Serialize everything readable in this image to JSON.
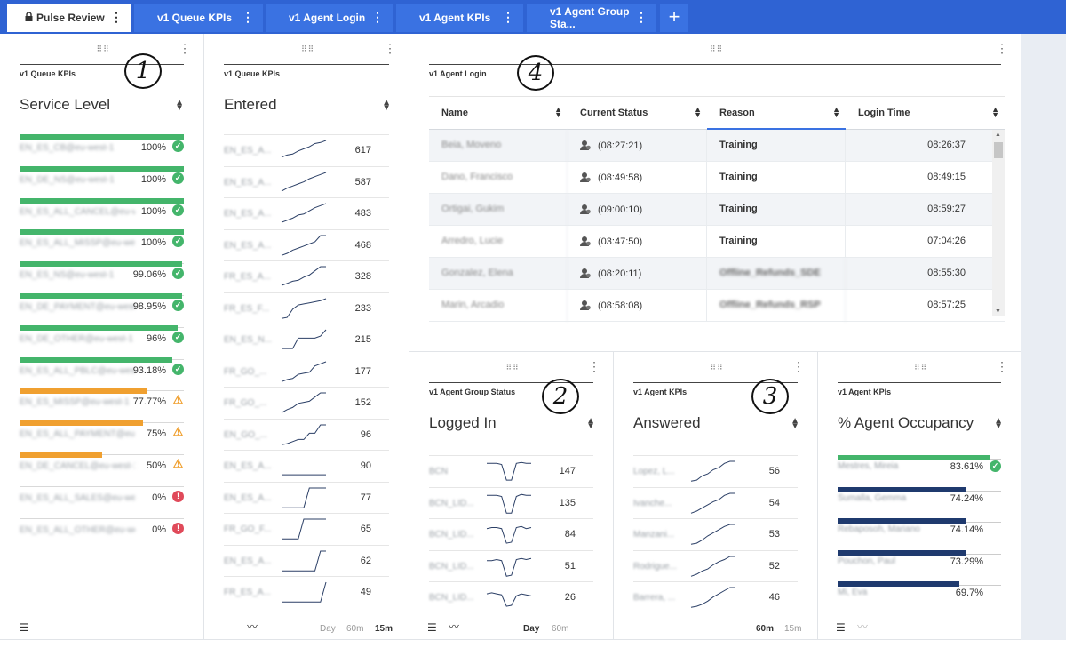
{
  "tabs": [
    {
      "label": "Pulse Review",
      "active": true,
      "locked": true
    },
    {
      "label": "v1 Queue KPIs"
    },
    {
      "label": "v1 Agent Login"
    },
    {
      "label": "v1 Agent KPIs"
    },
    {
      "label": "v1 Agent Group Sta..."
    }
  ],
  "add_tab_label": "+",
  "menu_glyph": "⋮",
  "drag_glyph": "⠿⠿",
  "callouts": [
    "1",
    "2",
    "3",
    "4"
  ],
  "service_level": {
    "label": "v1 Queue KPIs",
    "title": "Service Level",
    "rows": [
      {
        "name": "EN_ES_CB@eu-west-1",
        "value": "100%",
        "fill": 100,
        "status": "ok"
      },
      {
        "name": "EN_DE_NS@eu-west-1",
        "value": "100%",
        "fill": 100,
        "status": "ok"
      },
      {
        "name": "EN_ES_ALL_CANCEL@eu-we...",
        "value": "100%",
        "fill": 100,
        "status": "ok"
      },
      {
        "name": "EN_ES_ALL_MISSP@eu-we...",
        "value": "100%",
        "fill": 100,
        "status": "ok"
      },
      {
        "name": "EN_ES_NS@eu-west-1",
        "value": "99.06%",
        "fill": 99.06,
        "status": "ok"
      },
      {
        "name": "EN_DE_PAYMENT@eu-west",
        "value": "98.95%",
        "fill": 98.95,
        "status": "ok"
      },
      {
        "name": "EN_DE_OTHER@eu-west-1",
        "value": "96%",
        "fill": 96,
        "status": "ok"
      },
      {
        "name": "EN_ES_ALL_PBLC@eu-west",
        "value": "93.18%",
        "fill": 93.18,
        "status": "ok"
      },
      {
        "name": "EN_ES_MISSP@eu-west-1",
        "value": "77.77%",
        "fill": 77.77,
        "status": "warn"
      },
      {
        "name": "EN_ES_ALL_PAYMENT@eu...",
        "value": "75%",
        "fill": 75,
        "status": "warn"
      },
      {
        "name": "EN_DE_CANCEL@eu-west-1",
        "value": "50%",
        "fill": 50,
        "status": "warn"
      },
      {
        "name": "EN_ES_ALL_SALES@eu-we...",
        "value": "0%",
        "fill": 0,
        "status": "err"
      },
      {
        "name": "EN_ES_ALL_OTHER@eu-we...",
        "value": "0%",
        "fill": 0,
        "status": "err"
      }
    ],
    "colors": {
      "ok": "#44b56b",
      "warn": "#f0a030",
      "err": "#e04a5a"
    }
  },
  "entered": {
    "label": "v1 Queue KPIs",
    "title": "Entered",
    "rows": [
      {
        "name": "EN_ES_A...",
        "value": "617",
        "trend": [
          0.2,
          0.3,
          0.35,
          0.5,
          0.6,
          0.7,
          0.85,
          0.9,
          1
        ]
      },
      {
        "name": "EN_ES_A...",
        "value": "587",
        "trend": [
          0.1,
          0.25,
          0.35,
          0.45,
          0.55,
          0.7,
          0.8,
          0.9,
          1
        ]
      },
      {
        "name": "EN_ES_A...",
        "value": "483",
        "trend": [
          0.1,
          0.2,
          0.3,
          0.45,
          0.5,
          0.65,
          0.8,
          0.9,
          1
        ]
      },
      {
        "name": "EN_ES_A...",
        "value": "468",
        "trend": [
          0.05,
          0.15,
          0.3,
          0.4,
          0.5,
          0.6,
          0.7,
          1,
          1
        ]
      },
      {
        "name": "FR_ES_A...",
        "value": "328",
        "trend": [
          0.1,
          0.2,
          0.3,
          0.35,
          0.5,
          0.6,
          0.8,
          1,
          1
        ]
      },
      {
        "name": "FR_ES_F...",
        "value": "233",
        "trend": [
          0.05,
          0.1,
          0.5,
          0.7,
          0.75,
          0.8,
          0.85,
          0.9,
          1
        ]
      },
      {
        "name": "EN_ES_N...",
        "value": "215",
        "trend": [
          0.1,
          0.1,
          0.1,
          0.6,
          0.6,
          0.6,
          0.6,
          0.7,
          1
        ]
      },
      {
        "name": "FR_GO_...",
        "value": "177",
        "trend": [
          0.05,
          0.15,
          0.2,
          0.4,
          0.45,
          0.5,
          0.8,
          0.9,
          1
        ]
      },
      {
        "name": "FR_GO_...",
        "value": "152",
        "trend": [
          0.05,
          0.2,
          0.3,
          0.5,
          0.55,
          0.6,
          0.8,
          1,
          1
        ]
      },
      {
        "name": "EN_GO_...",
        "value": "96",
        "trend": [
          0.05,
          0.1,
          0.2,
          0.3,
          0.3,
          0.6,
          0.6,
          1,
          1
        ]
      },
      {
        "name": "EN_ES_A...",
        "value": "90",
        "trend": [
          0.1,
          0.1,
          0.1,
          0.1,
          0.1,
          0.1,
          0.1,
          0.1,
          0.1
        ]
      },
      {
        "name": "EN_ES_A...",
        "value": "77",
        "trend": [
          0.05,
          0.05,
          0.05,
          0.05,
          0.05,
          1,
          1,
          1,
          1
        ]
      },
      {
        "name": "FR_GO_F...",
        "value": "65",
        "trend": [
          0.05,
          0.05,
          0.05,
          0.05,
          1,
          1,
          1,
          1,
          1
        ]
      },
      {
        "name": "EN_ES_A...",
        "value": "62",
        "trend": [
          0.05,
          0.05,
          0.05,
          0.05,
          0.05,
          0.05,
          0.05,
          1,
          1
        ]
      },
      {
        "name": "FR_ES_A...",
        "value": "49",
        "trend": [
          0.05,
          0.05,
          0.05,
          0.05,
          0.05,
          0.05,
          0.05,
          0.05,
          1
        ]
      }
    ],
    "footer": {
      "day": "Day",
      "m60": "60m",
      "m15": "15m"
    }
  },
  "agent_login": {
    "label": "v1 Agent Login",
    "columns": [
      "Name",
      "Current Status",
      "Reason",
      "Login Time"
    ],
    "rows": [
      {
        "name": "Beia, Moveno",
        "status": "(08:27:21)",
        "reason": "Training",
        "reason_blurred": false,
        "login": "08:26:37"
      },
      {
        "name": "Dano, Francisco",
        "status": "(08:49:58)",
        "reason": "Training",
        "reason_blurred": false,
        "login": "08:49:15"
      },
      {
        "name": "Ortigai, Gukim",
        "status": "(09:00:10)",
        "reason": "Training",
        "reason_blurred": false,
        "login": "08:59:27"
      },
      {
        "name": "Arredro, Lucie",
        "status": "(03:47:50)",
        "reason": "Training",
        "reason_blurred": false,
        "login": "07:04:26"
      },
      {
        "name": "Gonzalez, Elena",
        "status": "(08:20:11)",
        "reason": "Offline_Refunds_SDE",
        "reason_blurred": true,
        "login": "08:55:30"
      },
      {
        "name": "Marin, Arcadio",
        "status": "(08:58:08)",
        "reason": "Offline_Refunds_RSP",
        "reason_blurred": true,
        "login": "08:57:25"
      }
    ]
  },
  "logged_in": {
    "label": "v1 Agent Group Status",
    "title": "Logged In",
    "rows": [
      {
        "name": "BCN",
        "value": "147",
        "trend": [
          0.9,
          0.9,
          0.9,
          0.85,
          0.1,
          0.1,
          0.9,
          0.95,
          0.9,
          0.9
        ]
      },
      {
        "name": "BCN_LID...",
        "value": "135",
        "trend": [
          0.9,
          0.9,
          0.9,
          0.85,
          0.05,
          0.05,
          0.85,
          0.95,
          0.9,
          0.9
        ]
      },
      {
        "name": "BCN_LID...",
        "value": "84",
        "trend": [
          0.8,
          0.85,
          0.85,
          0.8,
          0.1,
          0.15,
          0.85,
          0.9,
          0.8,
          0.85
        ]
      },
      {
        "name": "BCN_LID...",
        "value": "51",
        "trend": [
          0.8,
          0.8,
          0.85,
          0.8,
          0.05,
          0.1,
          0.85,
          0.9,
          0.85,
          0.9
        ]
      },
      {
        "name": "BCN_LID...",
        "value": "26",
        "trend": [
          0.7,
          0.75,
          0.7,
          0.65,
          0.1,
          0.15,
          0.6,
          0.7,
          0.65,
          0.6
        ]
      }
    ],
    "footer": {
      "day": "Day",
      "m60": "60m"
    }
  },
  "answered": {
    "label": "v1 Agent KPIs",
    "title": "Answered",
    "rows": [
      {
        "name": "Lopez, L...",
        "value": "56",
        "trend": [
          0.05,
          0.1,
          0.3,
          0.4,
          0.6,
          0.7,
          0.9,
          1,
          1
        ]
      },
      {
        "name": "Ivanche...",
        "value": "54",
        "trend": [
          0.05,
          0.15,
          0.3,
          0.45,
          0.6,
          0.7,
          0.9,
          1,
          1
        ]
      },
      {
        "name": "Manzani...",
        "value": "53",
        "trend": [
          0.05,
          0.1,
          0.25,
          0.45,
          0.6,
          0.75,
          0.9,
          1,
          1
        ]
      },
      {
        "name": "Rodrigue...",
        "value": "52",
        "trend": [
          0.05,
          0.15,
          0.3,
          0.4,
          0.6,
          0.75,
          0.85,
          1,
          1
        ]
      },
      {
        "name": "Barrera, ...",
        "value": "46",
        "trend": [
          0.05,
          0.1,
          0.2,
          0.35,
          0.55,
          0.7,
          0.85,
          1,
          1
        ]
      }
    ],
    "footer": {
      "m60": "60m",
      "m15": "15m"
    }
  },
  "occupancy": {
    "label": "v1 Agent KPIs",
    "title": "% Agent Occupancy",
    "rows": [
      {
        "name": "Mestres, Mireia",
        "value": "83.61%",
        "fill": 100,
        "color": "#44b56b",
        "check": true
      },
      {
        "name": "Sumalla, Gemma",
        "value": "74.24%",
        "fill": 85,
        "color": "#1f3a6e",
        "check": false
      },
      {
        "name": "Rebaposoh, Mariano",
        "value": "74.14%",
        "fill": 85,
        "color": "#1f3a6e",
        "check": false
      },
      {
        "name": "Pouchon, Paul",
        "value": "73.29%",
        "fill": 84,
        "color": "#1f3a6e",
        "check": false
      },
      {
        "name": "Mi, Eva",
        "value": "69.7%",
        "fill": 80,
        "color": "#1f3a6e",
        "check": false
      }
    ]
  }
}
